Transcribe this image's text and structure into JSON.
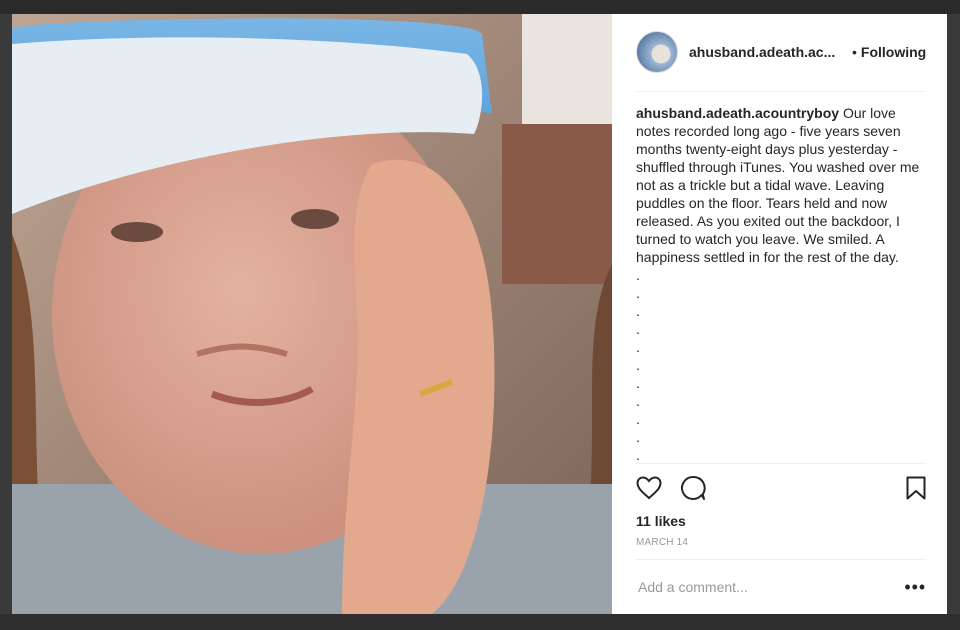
{
  "post": {
    "username": "ahusband.adeath.ac...",
    "follow_separator": "•",
    "follow_status": "Following",
    "caption_user": "ahusband.adeath.acountryboy",
    "caption_text": "Our love notes recorded long ago - five years seven months twenty-eight days plus yesterday - shuffled through iTunes. You washed over me not as a trickle but a tidal wave. Leaving puddles on the floor. Tears held and now released. As you exited out the backdoor, I turned to watch you leave. We smiled. A happiness settled in for the rest of the day.",
    "caption_dots": [
      ".",
      ".",
      ".",
      ".",
      ".",
      ".",
      ".",
      ".",
      ".",
      ".",
      "."
    ],
    "likes": "11 likes",
    "date": "MARCH 14",
    "comment_placeholder": "Add a comment...",
    "more_label": "•••"
  },
  "icons": {
    "like": "heart-icon",
    "comment": "comment-bubble-icon",
    "save": "bookmark-icon"
  },
  "colors": {
    "text": "#262626",
    "muted": "#999999",
    "divider": "#efefef"
  }
}
